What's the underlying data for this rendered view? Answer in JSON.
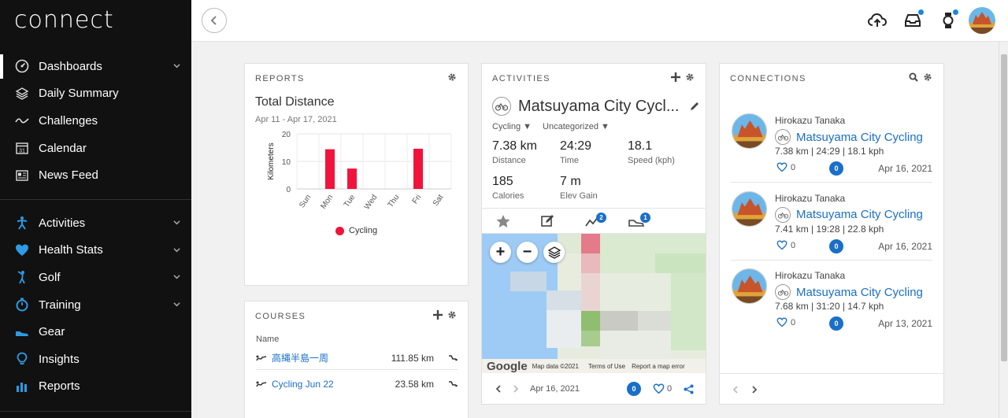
{
  "app": {
    "logo": "connect"
  },
  "sidebar": {
    "items": [
      {
        "label": "Dashboards",
        "icon": "speedometer-icon",
        "active": true,
        "chevron": true
      },
      {
        "label": "Daily Summary",
        "icon": "layers-icon",
        "chevron": false
      },
      {
        "label": "Challenges",
        "icon": "wave-icon",
        "chevron": false
      },
      {
        "label": "Calendar",
        "icon": "calendar-icon",
        "chevron": false,
        "day": "31"
      },
      {
        "label": "News Feed",
        "icon": "newspaper-icon",
        "chevron": false
      }
    ],
    "items2": [
      {
        "label": "Activities",
        "icon": "running-person-icon",
        "chevron": true
      },
      {
        "label": "Health Stats",
        "icon": "heart-icon",
        "chevron": true
      },
      {
        "label": "Golf",
        "icon": "golfer-icon",
        "chevron": true
      },
      {
        "label": "Training",
        "icon": "stopwatch-icon",
        "chevron": true
      },
      {
        "label": "Gear",
        "icon": "shoe-icon",
        "chevron": false
      },
      {
        "label": "Insights",
        "icon": "lightbulb-icon",
        "chevron": false
      },
      {
        "label": "Reports",
        "icon": "bar-chart-icon",
        "chevron": false
      }
    ]
  },
  "reports": {
    "title": "REPORTS",
    "chart_title": "Total Distance",
    "date_range": "Apr 11 - Apr 17, 2021",
    "legend_label": "Cycling"
  },
  "chart_data": {
    "type": "bar",
    "title": "Total Distance",
    "subtitle": "Apr 11 - Apr 17, 2021",
    "xlabel": "",
    "ylabel": "Kilometers",
    "categories": [
      "Sun",
      "Mon",
      "Tue",
      "Wed",
      "Thu",
      "Fri",
      "Sat"
    ],
    "series": [
      {
        "name": "Cycling",
        "values": [
          0,
          14.4,
          7.4,
          0,
          0,
          14.6,
          0
        ]
      }
    ],
    "y_ticks": [
      "0",
      "10",
      "20"
    ],
    "ylim": [
      0,
      20
    ],
    "grid": true,
    "legend": "bottom",
    "color": "#f0143c"
  },
  "courses": {
    "title": "COURSES",
    "header": "Name",
    "rows": [
      {
        "name": "高縄半島一周",
        "distance": "111.85 km"
      },
      {
        "name": "Cycling Jun 22",
        "distance": "23.58 km"
      }
    ]
  },
  "activities": {
    "title": "ACTIVITIES",
    "name": "Matsuyama City Cycl...",
    "type": "Cycling ▼",
    "category": "Uncategorized ▼",
    "stats": [
      {
        "value": "7.38 km",
        "label": "Distance"
      },
      {
        "value": "24:29",
        "label": "Time"
      },
      {
        "value": "18.1",
        "label": "Speed (kph)"
      },
      {
        "value": "185",
        "label": "Calories"
      },
      {
        "value": "7 m",
        "label": "Elev Gain"
      }
    ],
    "tab_badges": {
      "segments": "2",
      "shoe": "1"
    },
    "map": {
      "zoom_in": "+",
      "zoom_out": "−",
      "google": "Google",
      "map_data": "Map data ©2021",
      "terms": "Terms of Use",
      "report": "Report a map error"
    },
    "date": "Apr 16, 2021",
    "comments": "0",
    "likes": "0"
  },
  "connections": {
    "title": "CONNECTIONS",
    "items": [
      {
        "user": "Hirokazu Tanaka",
        "activity": "Matsuyama City Cycling",
        "stats": "7.38 km | 24:29 | 18.1 kph",
        "likes": "0",
        "comments": "0",
        "date": "Apr 16, 2021"
      },
      {
        "user": "Hirokazu Tanaka",
        "activity": "Matsuyama City Cycling",
        "stats": "7.41 km | 19:28 | 22.8 kph",
        "likes": "0",
        "comments": "0",
        "date": "Apr 16, 2021"
      },
      {
        "user": "Hirokazu Tanaka",
        "activity": "Matsuyama City Cycling",
        "stats": "7.68 km | 31:20 | 14.7 kph",
        "likes": "0",
        "comments": "0",
        "date": "Apr 13, 2021"
      }
    ]
  },
  "colors": {
    "accent": "#1a6fc7",
    "bar": "#f0143c",
    "sidebar_bg": "#111111"
  }
}
